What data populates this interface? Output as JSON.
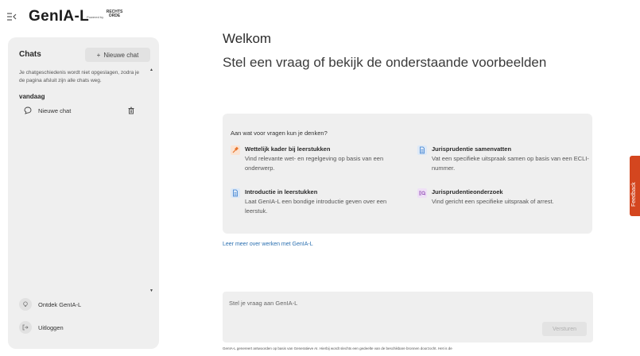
{
  "header": {
    "collapse_icon": "sidebar-collapse-icon",
    "brand": "GenIA-L",
    "powered_by": "Powered by",
    "partner_logo_line1": "RECHTS",
    "partner_logo_line2": "ORDE"
  },
  "sidebar": {
    "title": "Chats",
    "new_chat_label": "Nieuwe chat",
    "history_note": "Je chatgeschiedenis wordt niet opgeslagen, zodra je de pagina afsluit zijn alle chats weg.",
    "section_today": "vandaag",
    "chats": [
      {
        "label": "Nieuwe chat"
      }
    ],
    "bottom": {
      "discover": "Ontdek GenIA-L",
      "logout": "Uitloggen"
    }
  },
  "main": {
    "welcome": "Welkom",
    "headline": "Stel een vraag of bekijk de onderstaande voorbeelden",
    "examples_title": "Aan wat voor vragen kun je denken?",
    "examples": [
      {
        "title": "Wettelijk kader bij leerstukken",
        "desc": "Vind relevante wet- en regelgeving op basis van een onderwerp.",
        "icon": "gavel-icon",
        "color": "#e8742c"
      },
      {
        "title": "Jurisprudentie samenvatten",
        "desc": "Vat een specifieke uitspraak samen op basis van een ECLI-nummer.",
        "icon": "document-icon",
        "color": "#3a7fd0"
      },
      {
        "title": "Introductie in leerstukken",
        "desc": "Laat GenIA-L een bondige introductie geven over een leerstuk.",
        "icon": "document-icon",
        "color": "#3a7fd0"
      },
      {
        "title": "Jurisprudentieonderzoek",
        "desc": "Vind gericht een specifieke uitspraak of arrest.",
        "icon": "search-list-icon",
        "color": "#8a3fb0"
      }
    ],
    "learn_more": "Leer meer over werken met GenIA-L",
    "ask_placeholder": "Stel je vraag aan GenIA-L",
    "send_label": "Versturen",
    "disclaimer": "GenIA-L genereert antwoorden op basis van Generatieve AI. Hierbij wordt slechts een gedeelte van de beschikbare bronnen doorzocht. Het is de"
  },
  "feedback": {
    "label": "Feedback"
  }
}
